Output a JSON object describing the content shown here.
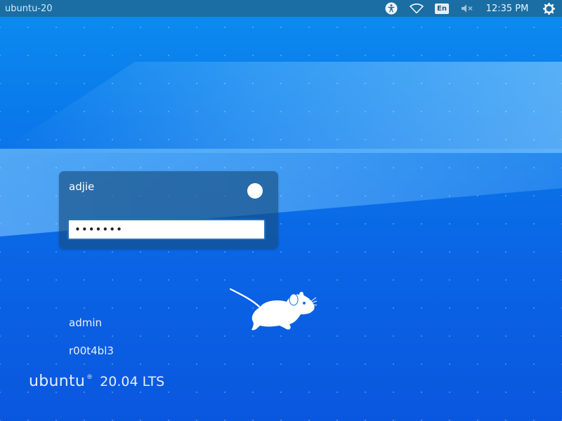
{
  "topbar": {
    "hostname": "ubuntu-20",
    "language": "En",
    "clock": "12:35 PM"
  },
  "icons": {
    "accessibility": "accessibility-icon",
    "network": "wifi-icon",
    "volume": "volume-muted-icon",
    "power": "power-icon",
    "session": "session-indicator-icon",
    "mascot": "xfce-mouse-logo"
  },
  "login": {
    "username": "adjie",
    "password_value": "•••••••"
  },
  "users": [
    {
      "name": "admin"
    },
    {
      "name": "r00t4bl3"
    }
  ],
  "branding": {
    "word": "ubuntu",
    "mark": "®",
    "version": "20.04 LTS"
  },
  "colors": {
    "panel": "#1a6ea3",
    "background_top": "#0c8cf0",
    "background_bottom": "#0a57df",
    "card": "#174c7c"
  }
}
